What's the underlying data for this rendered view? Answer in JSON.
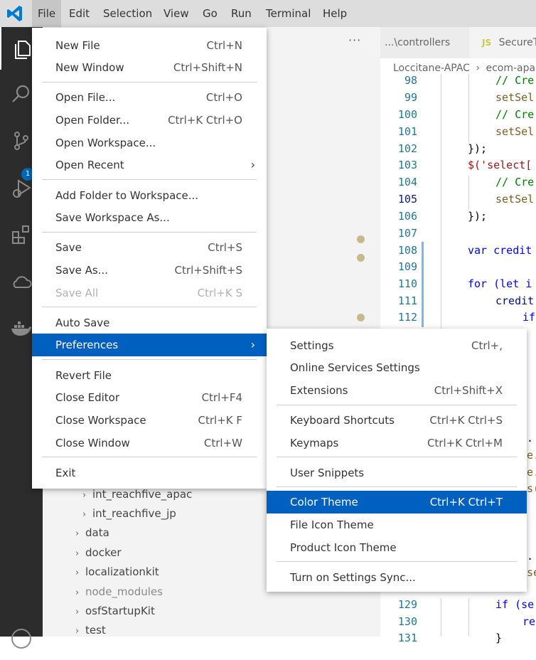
{
  "menubar": {
    "items": [
      "File",
      "Edit",
      "Selection",
      "View",
      "Go",
      "Run",
      "Terminal",
      "Help"
    ],
    "active": "File"
  },
  "activitybar": {
    "icons": [
      "explorer-icon",
      "search-icon",
      "source-control-icon",
      "run-debug-icon",
      "extensions-icon",
      "cloud-icon",
      "docker-icon"
    ],
    "source_control_badge": "1"
  },
  "sidebar": {
    "more_label": "···",
    "tree": [
      {
        "label": "int_reachfive_apac",
        "dim": false
      },
      {
        "label": "int_reachfive_jp",
        "dim": false
      },
      {
        "label": "data",
        "dim": false
      },
      {
        "label": "docker",
        "dim": false
      },
      {
        "label": "localizationkit",
        "dim": false
      },
      {
        "label": "node_modules",
        "dim": true
      },
      {
        "label": "osfStartupKit",
        "dim": false
      },
      {
        "label": "test",
        "dim": false
      }
    ]
  },
  "editor": {
    "tabs": [
      {
        "label": "...\\controllers"
      },
      {
        "label": "SecureT",
        "icon": "JS"
      }
    ],
    "breadcrumb": [
      "Loccitane-APAC",
      "ecom-apa"
    ],
    "lines": [
      {
        "n": "98",
        "text": "// Cre"
      },
      {
        "n": "99",
        "text": "setSel"
      },
      {
        "n": "100",
        "text": "// Cre"
      },
      {
        "n": "101",
        "text": "setSel"
      },
      {
        "n": "102",
        "text": "});"
      },
      {
        "n": "103",
        "text": "$('select["
      },
      {
        "n": "104",
        "text": "// Cre"
      },
      {
        "n": "105",
        "text": "setSel"
      },
      {
        "n": "106",
        "text": "});"
      },
      {
        "n": "107",
        "text": ""
      },
      {
        "n": "108",
        "text": "var credit"
      },
      {
        "n": "109",
        "text": ""
      },
      {
        "n": "110",
        "text": "for (let i"
      },
      {
        "n": "111",
        "text": "credit"
      },
      {
        "n": "112",
        "text": "if"
      },
      {
        "n": "129",
        "text": "if (se"
      },
      {
        "n": "130",
        "text": "re"
      },
      {
        "n": "131",
        "text": "}"
      }
    ],
    "partial_right": [
      ".",
      "e.",
      "e.",
      "s(",
      ".",
      "se"
    ]
  },
  "file_menu": {
    "groups": [
      [
        {
          "label": "New File",
          "key": "Ctrl+N"
        },
        {
          "label": "New Window",
          "key": "Ctrl+Shift+N"
        }
      ],
      [
        {
          "label": "Open File...",
          "key": "Ctrl+O"
        },
        {
          "label": "Open Folder...",
          "key": "Ctrl+K Ctrl+O"
        },
        {
          "label": "Open Workspace...",
          "key": ""
        },
        {
          "label": "Open Recent",
          "key": "",
          "submenu": true
        }
      ],
      [
        {
          "label": "Add Folder to Workspace...",
          "key": ""
        },
        {
          "label": "Save Workspace As...",
          "key": ""
        }
      ],
      [
        {
          "label": "Save",
          "key": "Ctrl+S"
        },
        {
          "label": "Save As...",
          "key": "Ctrl+Shift+S"
        },
        {
          "label": "Save All",
          "key": "Ctrl+K S",
          "disabled": true
        }
      ],
      [
        {
          "label": "Auto Save",
          "key": ""
        },
        {
          "label": "Preferences",
          "key": "",
          "submenu": true,
          "selected": true
        }
      ],
      [
        {
          "label": "Revert File",
          "key": ""
        },
        {
          "label": "Close Editor",
          "key": "Ctrl+F4"
        },
        {
          "label": "Close Workspace",
          "key": "Ctrl+K F"
        },
        {
          "label": "Close Window",
          "key": "Ctrl+W"
        }
      ],
      [
        {
          "label": "Exit",
          "key": ""
        }
      ]
    ]
  },
  "preferences_menu": {
    "groups": [
      [
        {
          "label": "Settings",
          "key": "Ctrl+,"
        },
        {
          "label": "Online Services Settings",
          "key": ""
        },
        {
          "label": "Extensions",
          "key": "Ctrl+Shift+X"
        }
      ],
      [
        {
          "label": "Keyboard Shortcuts",
          "key": "Ctrl+K Ctrl+S"
        },
        {
          "label": "Keymaps",
          "key": "Ctrl+K Ctrl+M"
        }
      ],
      [
        {
          "label": "User Snippets",
          "key": ""
        }
      ],
      [
        {
          "label": "Color Theme",
          "key": "Ctrl+K Ctrl+T",
          "selected": true
        },
        {
          "label": "File Icon Theme",
          "key": ""
        },
        {
          "label": "Product Icon Theme",
          "key": ""
        }
      ],
      [
        {
          "label": "Turn on Settings Sync...",
          "key": ""
        }
      ]
    ]
  },
  "colors": {
    "selection": "#0060c0",
    "activitybar": "#2c2c2c",
    "titlebar": "#dddddd",
    "badge": "#0066b8"
  }
}
